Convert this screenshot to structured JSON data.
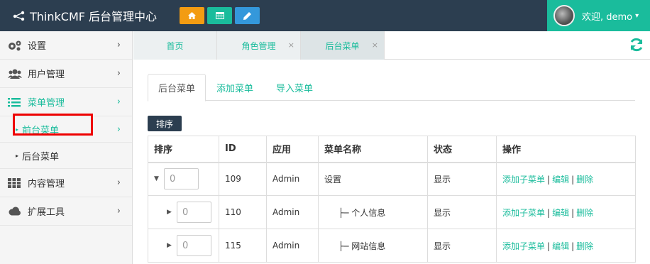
{
  "brand": {
    "title": "ThinkCMF 后台管理中心"
  },
  "top_buttons": [
    {
      "icon": "home-icon"
    },
    {
      "icon": "grid-icon"
    },
    {
      "icon": "pencil-icon"
    }
  ],
  "user": {
    "greeting": "欢迎, demo",
    "caret": "▾"
  },
  "sidebar": {
    "items": [
      {
        "label": "设置",
        "icon": "gears-icon"
      },
      {
        "label": "用户管理",
        "icon": "users-icon"
      },
      {
        "label": "菜单管理",
        "icon": "list-icon"
      },
      {
        "label": "内容管理",
        "icon": "th-icon"
      },
      {
        "label": "扩展工具",
        "icon": "cloud-icon"
      }
    ],
    "sub_items": [
      {
        "label": "前台菜单"
      },
      {
        "label": "后台菜单"
      }
    ],
    "chevron": "›",
    "sub_arrow": "▸"
  },
  "tabs": [
    {
      "label": "首页"
    },
    {
      "label": "角色管理",
      "close": "×"
    },
    {
      "label": "后台菜单",
      "close": "×"
    }
  ],
  "subtabs": [
    {
      "label": "后台菜单"
    },
    {
      "label": "添加菜单"
    },
    {
      "label": "导入菜单"
    }
  ],
  "sort_button": "排序",
  "table": {
    "headers": [
      "排序",
      "ID",
      "应用",
      "菜单名称",
      "状态",
      "操作"
    ],
    "rows": [
      {
        "arrow": "▼",
        "order": "0",
        "id": "109",
        "app": "Admin",
        "name": "设置",
        "status": "显示"
      },
      {
        "arrow": "▶",
        "order": "0",
        "id": "110",
        "app": "Admin",
        "name": "├─ 个人信息",
        "status": "显示"
      },
      {
        "arrow": "▶",
        "order": "0",
        "id": "115",
        "app": "Admin",
        "name": "├─ 网站信息",
        "status": "显示"
      }
    ],
    "actions": {
      "add_child": "添加子菜单",
      "edit": "编辑",
      "delete": "删除",
      "sep": "|"
    }
  },
  "colors": {
    "navbar": "#2c3e50",
    "accent": "#1abc9c",
    "orange": "#f39c12",
    "blue": "#3498db",
    "highlight": "#ee0000"
  }
}
